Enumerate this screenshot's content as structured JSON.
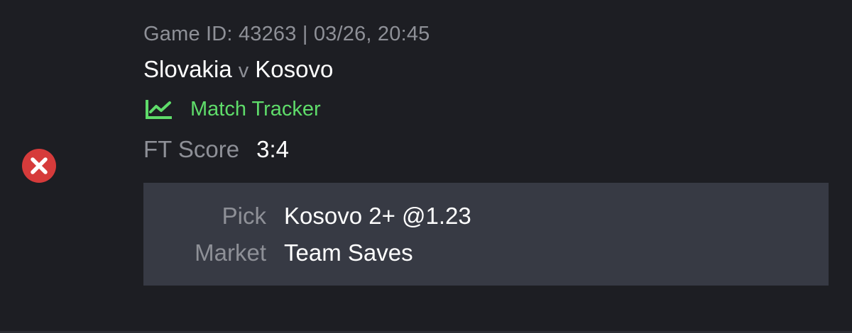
{
  "status": {
    "icon": "lost-x-icon",
    "color": "#d63b3b"
  },
  "game": {
    "meta": "Game ID: 43263 | 03/26, 20:45",
    "home_team": "Slovakia",
    "separator": "v",
    "away_team": "Kosovo"
  },
  "tracker": {
    "icon": "chart-line-icon",
    "label": "Match Tracker",
    "color": "#5fdc6a"
  },
  "score": {
    "label": "FT Score",
    "value": "3:4"
  },
  "pick": {
    "pick_label": "Pick",
    "pick_value": "Kosovo 2+ @1.23",
    "market_label": "Market",
    "market_value": "Team Saves"
  }
}
